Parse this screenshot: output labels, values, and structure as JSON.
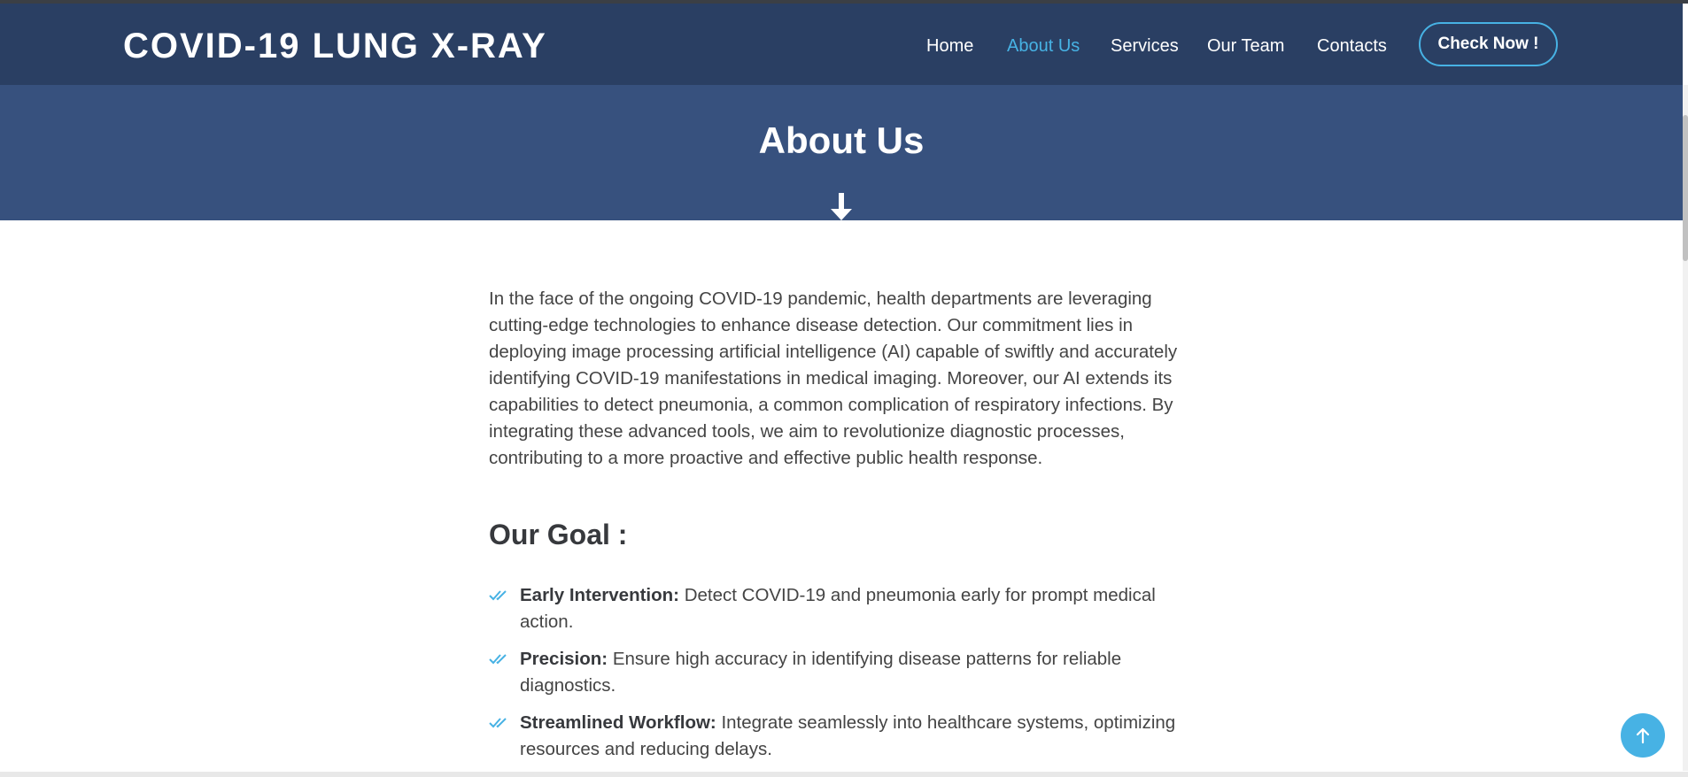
{
  "header": {
    "logo": "COVID-19 LUNG X-RAY",
    "nav": {
      "home": "Home",
      "about": "About Us",
      "services": "Services",
      "team": "Our Team",
      "contacts": "Contacts"
    },
    "cta_label": "Check Now !"
  },
  "banner": {
    "title": "About Us"
  },
  "about": {
    "intro": "In the face of the ongoing COVID-19 pandemic, health departments are leveraging cutting-edge technologies to enhance disease detection. Our commitment lies in deploying image processing artificial intelligence (AI) capable of swiftly and accurately identifying COVID-19 manifestations in medical imaging. Moreover, our AI extends its capabilities to detect pneumonia, a common complication of respiratory infections. By integrating these advanced tools, we aim to revolutionize diagnostic processes, contributing to a more proactive and effective public health response.",
    "goal_title": "Our Goal :",
    "goals": [
      {
        "title": "Early Intervention:",
        "text": " Detect COVID-19 and pneumonia early for prompt medical action."
      },
      {
        "title": "Precision:",
        "text": " Ensure high accuracy in identifying disease patterns for reliable diagnostics."
      },
      {
        "title": "Streamlined Workflow:",
        "text": " Integrate seamlessly into healthcare systems, optimizing resources and reducing delays."
      }
    ]
  },
  "icons": {
    "down_arrow": "arrow-down-icon",
    "check": "double-check-icon",
    "back_to_top": "arrow-up-icon"
  },
  "colors": {
    "header_bg": "#2a3f63",
    "banner_bg": "#37517e",
    "accent": "#47b2e4"
  }
}
